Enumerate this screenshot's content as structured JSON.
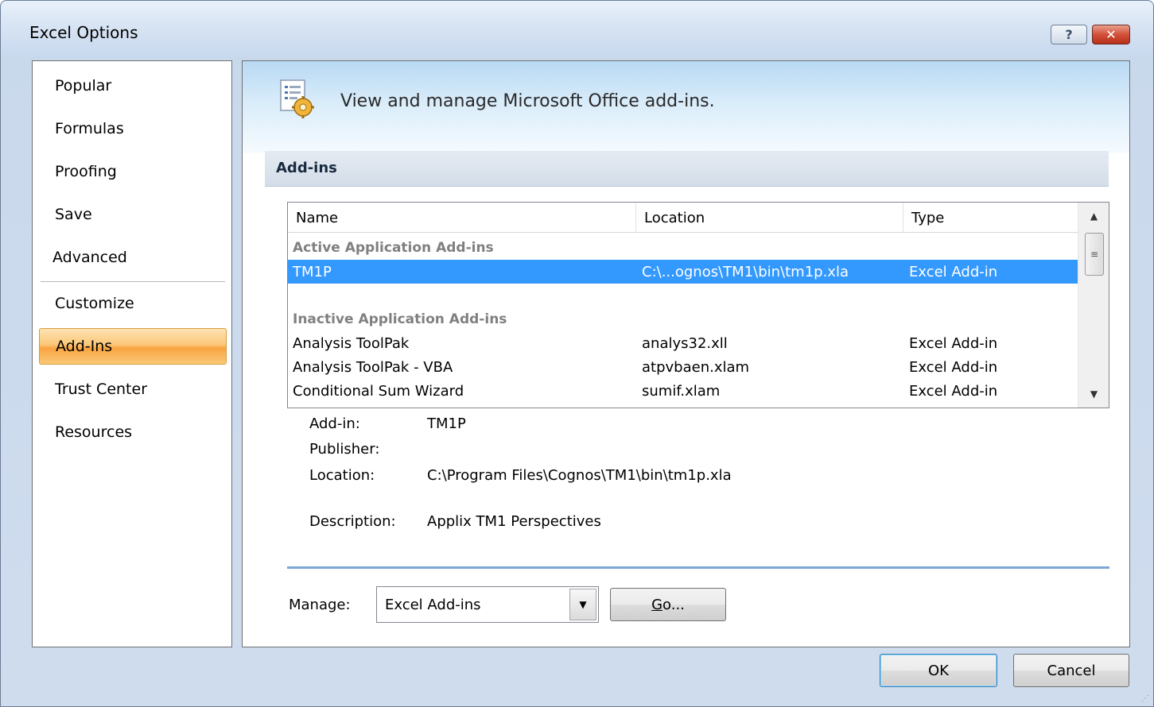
{
  "window": {
    "title": "Excel Options",
    "help_glyph": "?",
    "close_glyph": "✕"
  },
  "sidebar": {
    "items": [
      {
        "label": "Popular"
      },
      {
        "label": "Formulas"
      },
      {
        "label": "Proofing"
      },
      {
        "label": "Save"
      },
      {
        "label": "Advanced"
      },
      {
        "label": "Customize"
      },
      {
        "label": "Add-Ins",
        "active": true
      },
      {
        "label": "Trust Center"
      },
      {
        "label": "Resources"
      }
    ]
  },
  "main": {
    "banner_text": "View and manage Microsoft Office add-ins.",
    "banner_icon": "addins-gear-icon",
    "section_title": "Add-ins",
    "list": {
      "columns": [
        "Name",
        "Location",
        "Type"
      ],
      "groups": [
        {
          "title": "Active Application Add-ins",
          "rows": [
            {
              "name": "TM1P",
              "location": "C:\\...ognos\\TM1\\bin\\tm1p.xla",
              "type": "Excel Add-in",
              "selected": true
            }
          ]
        },
        {
          "title": "Inactive Application Add-ins",
          "rows": [
            {
              "name": "Analysis ToolPak",
              "location": "analys32.xll",
              "type": "Excel Add-in"
            },
            {
              "name": "Analysis ToolPak - VBA",
              "location": "atpvbaen.xlam",
              "type": "Excel Add-in"
            },
            {
              "name": "Conditional Sum Wizard",
              "location": "sumif.xlam",
              "type": "Excel Add-in"
            }
          ]
        }
      ]
    },
    "details": {
      "addin_label": "Add-in:",
      "addin_value": "TM1P",
      "publisher_label": "Publisher:",
      "publisher_value": "",
      "location_label": "Location:",
      "location_value": "C:\\Program Files\\Cognos\\TM1\\bin\\tm1p.xla",
      "description_label": "Description:",
      "description_value": "Applix TM1 Perspectives"
    },
    "manage": {
      "label": "Manage:",
      "selected": "Excel Add-ins",
      "go_label_accel": "G",
      "go_label_rest": "o..."
    }
  },
  "footer": {
    "ok_label": "OK",
    "cancel_label": "Cancel"
  }
}
